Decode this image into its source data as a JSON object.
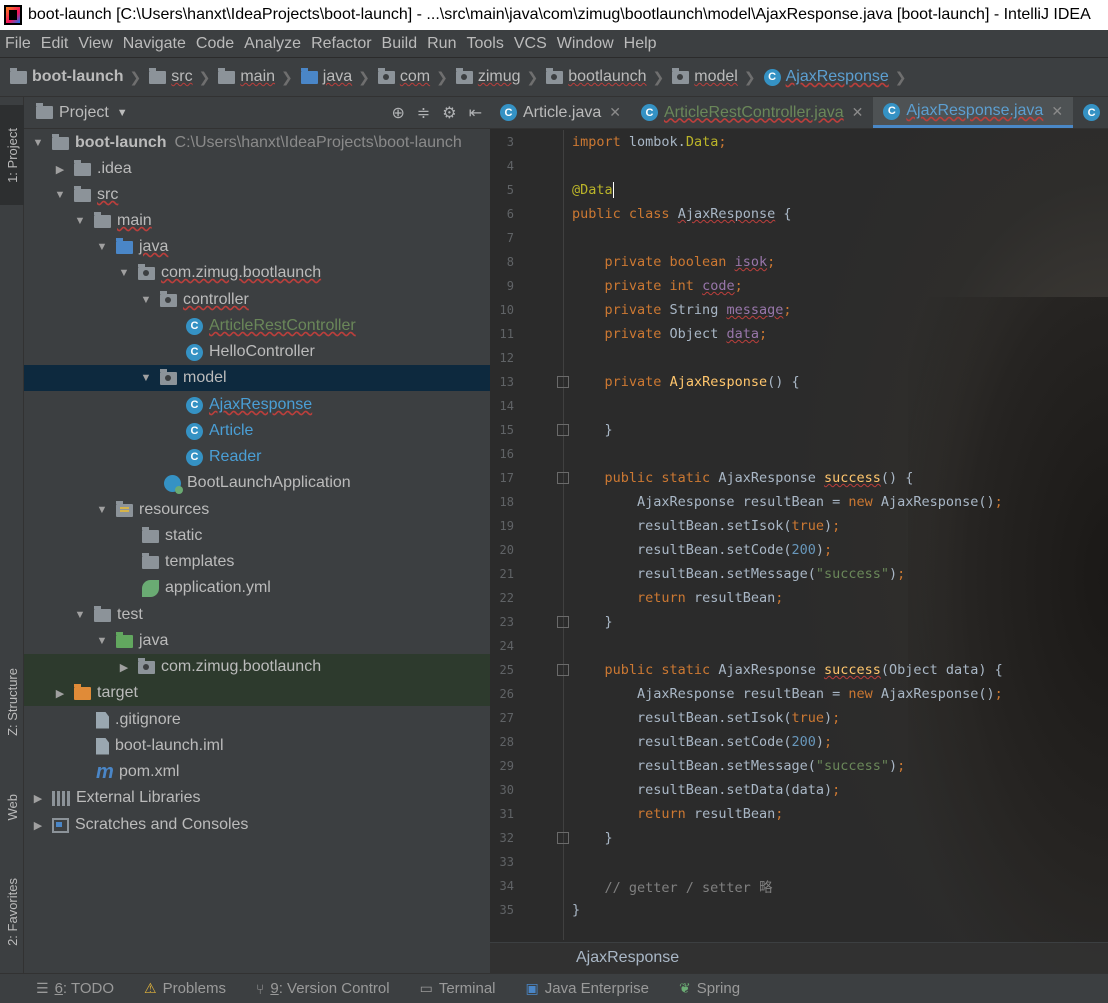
{
  "window": {
    "title": "boot-launch [C:\\Users\\hanxt\\IdeaProjects\\boot-launch] - ...\\src\\main\\java\\com\\zimug\\bootlaunch\\model\\AjaxResponse.java [boot-launch] - IntelliJ IDEA"
  },
  "menu": [
    "File",
    "Edit",
    "View",
    "Navigate",
    "Code",
    "Analyze",
    "Refactor",
    "Build",
    "Run",
    "Tools",
    "VCS",
    "Window",
    "Help"
  ],
  "navbar": {
    "crumbs": [
      "boot-launch",
      "src",
      "main",
      "java",
      "com",
      "zimug",
      "bootlaunch",
      "model",
      "AjaxResponse"
    ]
  },
  "left_strip": {
    "project": "1: Project",
    "structure": "Z: Structure",
    "web": "Web",
    "favorites": "2: Favorites"
  },
  "project_panel": {
    "title": "Project",
    "tree": [
      {
        "label": "boot-launch",
        "note": "C:\\Users\\hanxt\\IdeaProjects\\boot-launch"
      },
      {
        "label": ".idea"
      },
      {
        "label": "src"
      },
      {
        "label": "main"
      },
      {
        "label": "java"
      },
      {
        "label": "com.zimug.bootlaunch"
      },
      {
        "label": "controller"
      },
      {
        "label": "ArticleRestController"
      },
      {
        "label": "HelloController"
      },
      {
        "label": "model"
      },
      {
        "label": "AjaxResponse"
      },
      {
        "label": "Article"
      },
      {
        "label": "Reader"
      },
      {
        "label": "BootLaunchApplication"
      },
      {
        "label": "resources"
      },
      {
        "label": "static"
      },
      {
        "label": "templates"
      },
      {
        "label": "application.yml"
      },
      {
        "label": "test"
      },
      {
        "label": "java"
      },
      {
        "label": "com.zimug.bootlaunch"
      },
      {
        "label": "target"
      },
      {
        "label": ".gitignore"
      },
      {
        "label": "boot-launch.iml"
      },
      {
        "label": "pom.xml"
      },
      {
        "label": "External Libraries"
      },
      {
        "label": "Scratches and Consoles"
      }
    ]
  },
  "editor": {
    "tabs": [
      {
        "label": "Article.java"
      },
      {
        "label": "ArticleRestController.java"
      },
      {
        "label": "AjaxResponse.java"
      }
    ],
    "line_numbers": [
      "3",
      "4",
      "5",
      "6",
      "7",
      "8",
      "9",
      "10",
      "11",
      "12",
      "13",
      "14",
      "15",
      "16",
      "17",
      "18",
      "19",
      "20",
      "21",
      "22",
      "23",
      "24",
      "25",
      "26",
      "27",
      "28",
      "29",
      "30",
      "31",
      "32",
      "33",
      "34",
      "35"
    ],
    "code_tokens": {
      "l3": [
        "import",
        " lombok.",
        "Data",
        ";"
      ],
      "l5": [
        "@Data"
      ],
      "l6": [
        "public class",
        " ",
        "AjaxResponse",
        " {"
      ],
      "l8": [
        "private boolean",
        " ",
        "isok",
        ";"
      ],
      "l9": [
        "private int",
        " ",
        "code",
        ";"
      ],
      "l10": [
        "private",
        " String ",
        "message",
        ";"
      ],
      "l11": [
        "private",
        " Object ",
        "data",
        ";"
      ],
      "l13": [
        "private",
        " ",
        "AjaxResponse",
        "() {"
      ],
      "l15": [
        "}"
      ],
      "l17": [
        "public static",
        " AjaxResponse ",
        "success",
        "() {"
      ],
      "l18": [
        "AjaxResponse resultBean = ",
        "new",
        " AjaxResponse()",
        ";"
      ],
      "l19": [
        "resultBean.setIsok(",
        "true",
        ")",
        ";"
      ],
      "l20": [
        "resultBean.setCode(",
        "200",
        ")",
        ";"
      ],
      "l21": [
        "resultBean.setMessage(",
        "\"success\"",
        ")",
        ";"
      ],
      "l22": [
        "return",
        " resultBean",
        ";"
      ],
      "l23": [
        "}"
      ],
      "l25": [
        "public static",
        " AjaxResponse ",
        "success",
        "(Object data) {"
      ],
      "l26": [
        "AjaxResponse resultBean = ",
        "new",
        " AjaxResponse()",
        ";"
      ],
      "l27": [
        "resultBean.setIsok(",
        "true",
        ")",
        ";"
      ],
      "l28": [
        "resultBean.setCode(",
        "200",
        ")",
        ";"
      ],
      "l29": [
        "resultBean.setMessage(",
        "\"success\"",
        ")",
        ";"
      ],
      "l30": [
        "resultBean.setData(data)",
        ";"
      ],
      "l31": [
        "return",
        " resultBean",
        ";"
      ],
      "l32": [
        "}"
      ],
      "l34": [
        "// getter / setter 略"
      ],
      "l35": [
        "}"
      ]
    },
    "bottom_breadcrumb": "AjaxResponse"
  },
  "statusbar": {
    "items": [
      {
        "key": "6",
        "label": ": TODO"
      },
      {
        "key": "",
        "label": "Problems"
      },
      {
        "key": "9",
        "label": ": Version Control"
      },
      {
        "key": "",
        "label": "Terminal"
      },
      {
        "key": "",
        "label": "Java Enterprise"
      },
      {
        "key": "",
        "label": "Spring"
      }
    ]
  },
  "colors": {
    "background": "#2b2b2b",
    "panel": "#3c3f41",
    "selection": "#0d293e",
    "keyword": "#cc7832",
    "annotation": "#bbb529",
    "string": "#6a8759",
    "number": "#6897bb",
    "field": "#9876aa",
    "method": "#ffc66d",
    "accent": "#4a88c7"
  },
  "icons": [
    "intellij-app-icon",
    "folder-icon",
    "package-icon",
    "class-icon",
    "spring-boot-icon",
    "spring-icon",
    "maven-icon",
    "libraries-icon",
    "scratch-icon",
    "gear-icon",
    "target-icon",
    "collapse-icon",
    "hide-icon",
    "close-icon",
    "todo-icon",
    "warning-icon",
    "vcs-icon",
    "terminal-icon"
  ]
}
